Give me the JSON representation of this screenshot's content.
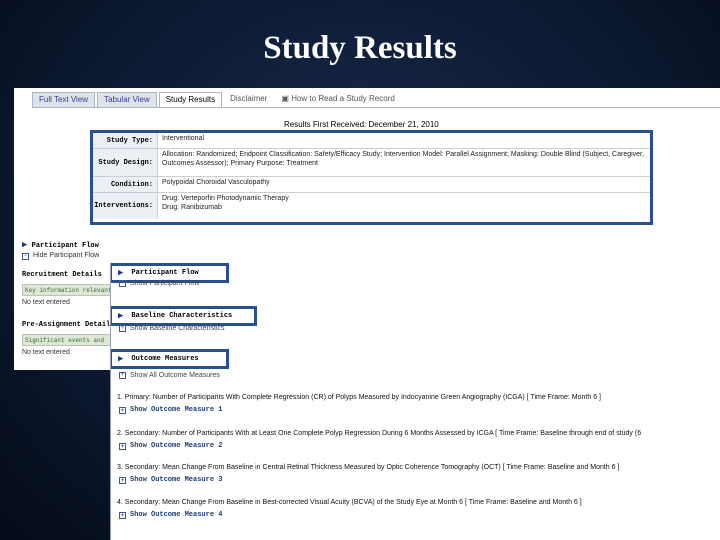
{
  "slide_title": "Study Results",
  "tabs": [
    {
      "label": "Full Text View"
    },
    {
      "label": "Tabular View"
    },
    {
      "label": "Study Results"
    },
    {
      "label": "Disclaimer"
    },
    {
      "label": "How to Read a Study Record"
    }
  ],
  "results_first_received": "Results First Received: December 21, 2010",
  "info_table": [
    {
      "label": "Study Type:",
      "value": "Interventional"
    },
    {
      "label": "Study Design:",
      "value": "Allocation: Randomized;  Endpoint Classification: Safety/Efficacy Study;  Intervention Model: Parallel Assignment;  Masking: Double Blind (Subject, Caregiver, Outcomes Assessor);  Primary Purpose: Treatment"
    },
    {
      "label": "Condition:",
      "value": "Polypoidal Choroidal Vasculopathy"
    },
    {
      "label": "Interventions:",
      "value": "Drug: Verteporfin Photodynamic Therapy\nDrug: Ranibizumab"
    }
  ],
  "left_panel": {
    "participant_flow": "Participant Flow",
    "hide_participant_flow": "Hide Participant Flow",
    "recruitment_details": "Recruitment Details",
    "recruitment_box": "Key information relevant",
    "not_entered_1": "No text entered",
    "preassignment_details": "Pre-Assignment Details",
    "preassignment_box": "Significant events and",
    "not_entered_2": "No text entered"
  },
  "sections": [
    {
      "header": "Participant Flow",
      "show": "Show Participant Flow"
    },
    {
      "header": "Baseline Characteristics",
      "show": "Show Baseline Characteristics"
    },
    {
      "header": "Outcome Measures",
      "show": "Show All Outcome Measures"
    }
  ],
  "measures": [
    {
      "text": "1.  Primary: Number of Participants With Complete Regression (CR) of Polyps Measured by Indocyanine Green Angiography (ICGA)   [ Time Frame: Month 6 ]",
      "link": "Show Outcome Measure 1"
    },
    {
      "text": "2.  Secondary: Number of Participants With at Least One Complete Polyp Regression During 6 Months Assessed by ICGA   [ Time Frame: Baseline through end of study (6",
      "link": "Show Outcome Measure 2"
    },
    {
      "text": "3.  Secondary: Mean Change From Baseline in Central Retinal Thickness Measured by Optic Coherence Tomography (OCT)   [ Time Frame: Baseline and Month 6 ]",
      "link": "Show Outcome Measure 3"
    },
    {
      "text": "4.  Secondary: Mean Change From Baseline in Best-corrected Visual Acuity (BCVA) of the Study Eye at Month 6   [ Time Frame: Baseline and Month 6 ]",
      "link": "Show Outcome Measure 4"
    }
  ],
  "colors": {
    "highlight_border": "#2a4f8d",
    "slide_bg": "#0c1a33"
  }
}
